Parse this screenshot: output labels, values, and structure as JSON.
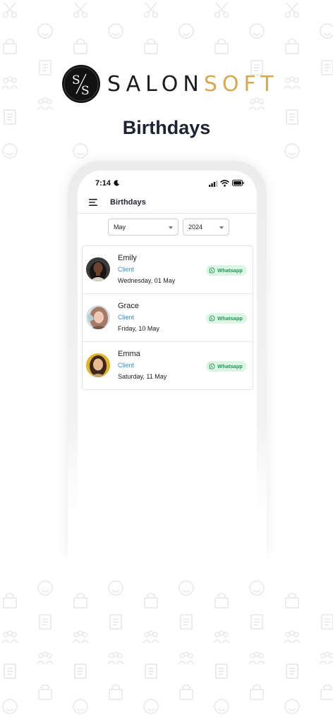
{
  "brand": {
    "logo_part1": "SALON",
    "logo_part2": "SOFT",
    "colors": {
      "dark": "#121212",
      "gold": "#d9a84a"
    }
  },
  "hero": {
    "title": "Birthdays"
  },
  "phone": {
    "status_bar": {
      "time": "7:14"
    },
    "app_bar": {
      "title": "Birthdays"
    },
    "filters": {
      "month": "May",
      "year": "2024"
    },
    "birthdays": [
      {
        "name": "Emily",
        "role": "Client",
        "date": "Wednesday, 01 May",
        "action_label": "Whatsapp"
      },
      {
        "name": "Grace",
        "role": "Client",
        "date": "Friday, 10 May",
        "action_label": "Whatsapp"
      },
      {
        "name": "Emma",
        "role": "Client",
        "date": "Saturday, 11 May",
        "action_label": "Whatsapp"
      }
    ]
  },
  "colors": {
    "accent_blue": "#3a8fd6",
    "whatsapp_green": "#1f9a52",
    "whatsapp_bg": "#dcf5e6"
  }
}
